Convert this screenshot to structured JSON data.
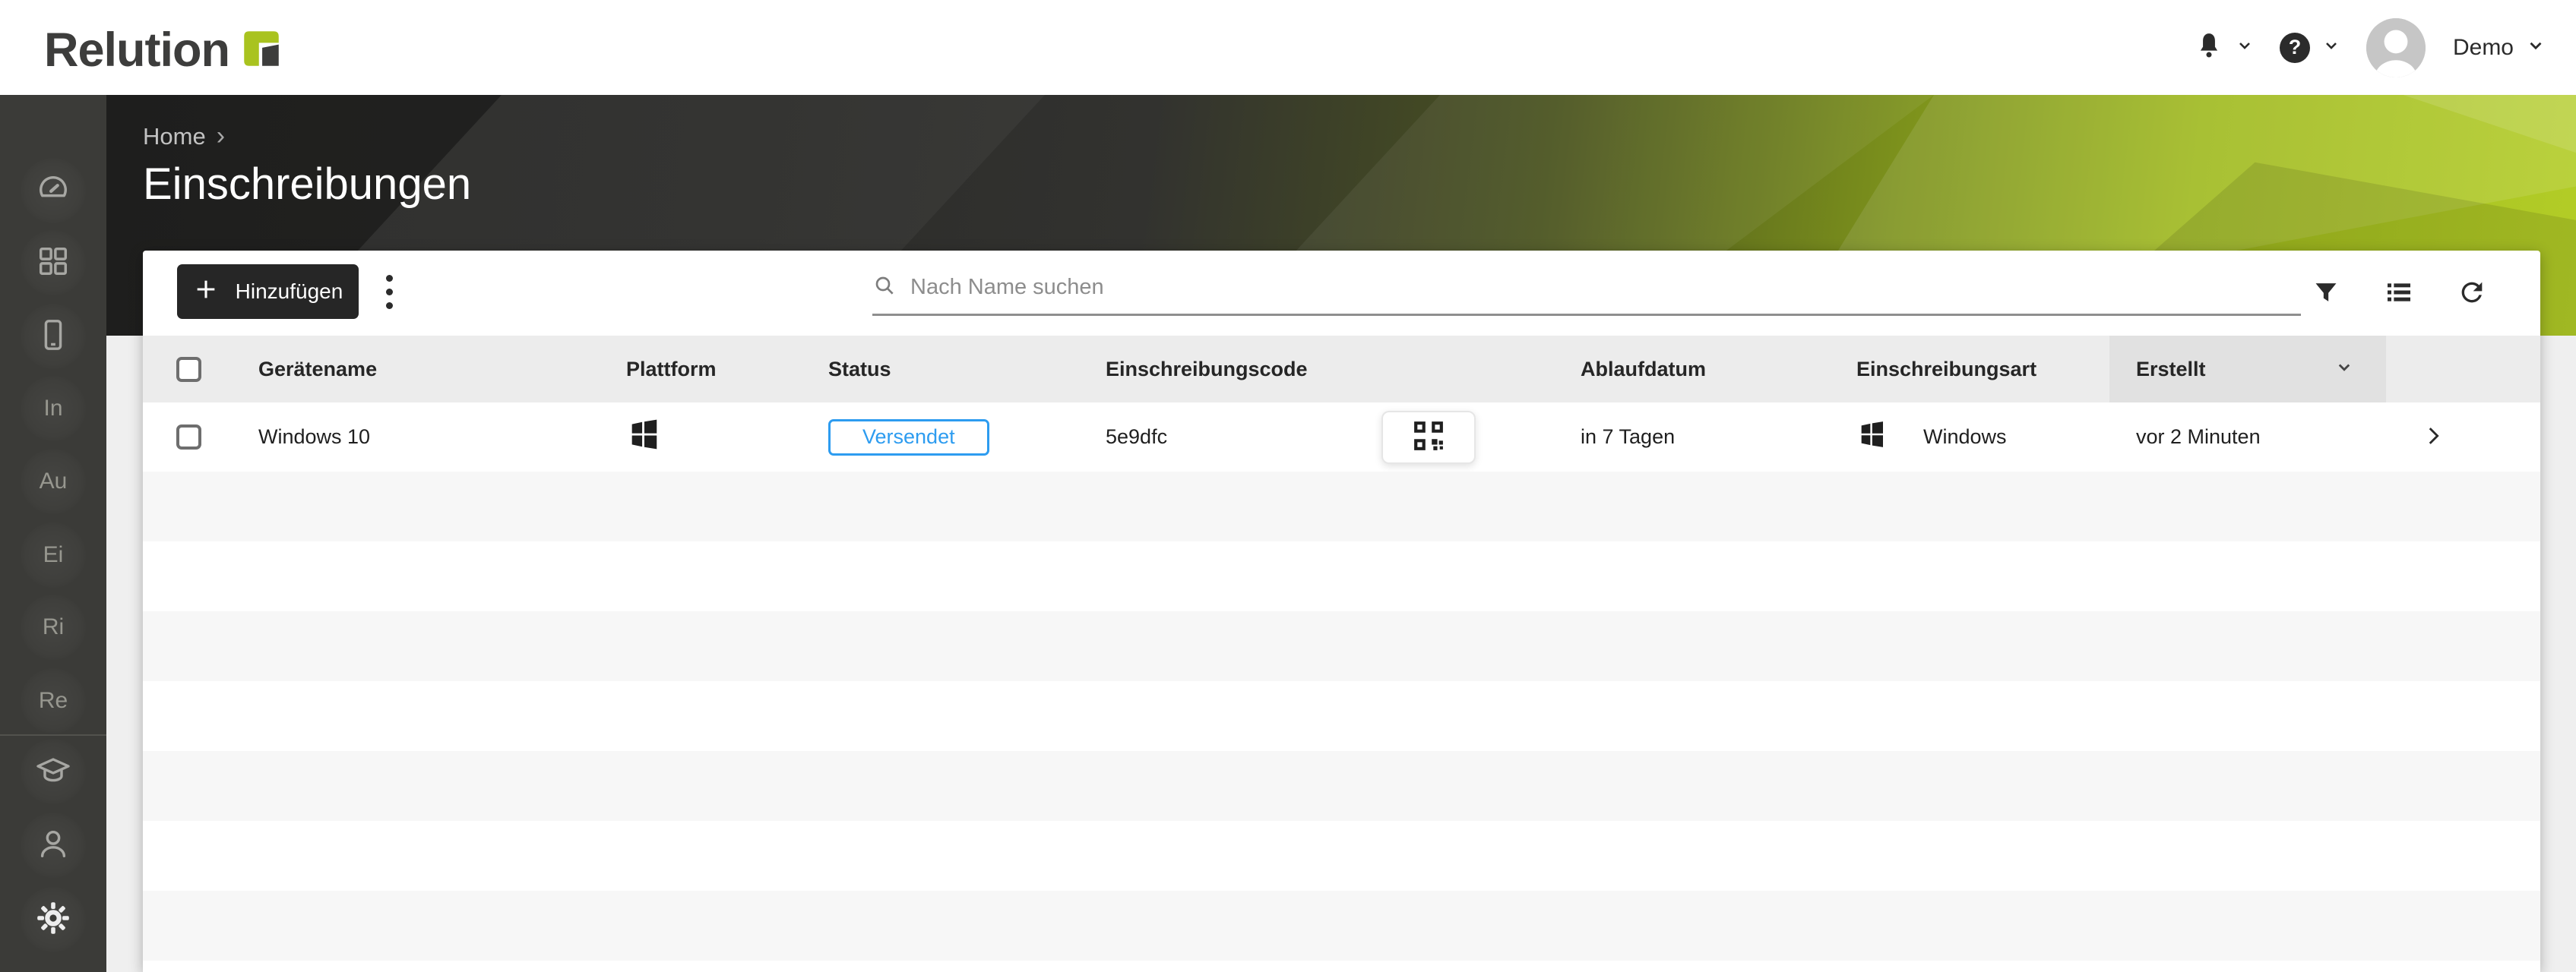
{
  "header": {
    "logo_text": "Relution",
    "user_name": "Demo"
  },
  "banner": {
    "breadcrumb_home": "Home",
    "breadcrumb_separator": "›",
    "page_title": "Einschreibungen"
  },
  "sidebar": {
    "items": [
      {
        "icon": "dashboard-gauge",
        "label": ""
      },
      {
        "icon": "apps-grid",
        "label": ""
      },
      {
        "icon": "device-phone",
        "label": ""
      },
      {
        "icon": "text-shortcut",
        "label": "In"
      },
      {
        "icon": "text-shortcut",
        "label": "Au"
      },
      {
        "icon": "text-shortcut",
        "label": "Ei"
      },
      {
        "icon": "text-shortcut",
        "label": "Ri"
      },
      {
        "icon": "text-shortcut",
        "label": "Re"
      },
      {
        "icon": "education-cap",
        "label": ""
      },
      {
        "icon": "users-person",
        "label": ""
      },
      {
        "icon": "settings-gear",
        "label": ""
      }
    ]
  },
  "toolbar": {
    "add_label": "Hinzufügen",
    "search_placeholder": "Nach Name suchen"
  },
  "table": {
    "columns": [
      {
        "label": ""
      },
      {
        "label": "Gerätename"
      },
      {
        "label": "Plattform"
      },
      {
        "label": "Status"
      },
      {
        "label": "Einschreibungscode"
      },
      {
        "label": ""
      },
      {
        "label": "Ablaufdatum"
      },
      {
        "label": "Einschreibungsart"
      },
      {
        "label": "Erstellt"
      },
      {
        "label": ""
      }
    ],
    "sorted_column": "Erstellt",
    "rows": [
      {
        "device_name": "Windows 10",
        "platform_icon": "windows-logo",
        "status": "Versendet",
        "code": "5e9dfc",
        "expiry": "in 7 Tagen",
        "type_label": "Windows",
        "created": "vor 2 Minuten"
      }
    ]
  },
  "colors": {
    "accent_green": "#a9c31f",
    "status_blue": "#2d9cf0",
    "sidebar_dark": "#3b3b38",
    "button_dark": "#262626"
  }
}
